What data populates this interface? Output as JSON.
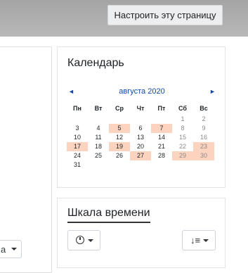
{
  "header": {
    "customize_label": "Настроить эту страницу"
  },
  "main": {
    "select_value": "а"
  },
  "calendar": {
    "title": "Календарь",
    "month": "августа 2020",
    "prev_symbol": "◄",
    "next_symbol": "►",
    "weekdays": [
      "Пн",
      "Вт",
      "Ср",
      "Чт",
      "Пт",
      "Сб",
      "Вс"
    ],
    "weeks": [
      [
        "",
        "",
        "",
        "",
        "",
        "1",
        "2"
      ],
      [
        "3",
        "4",
        "5",
        "6",
        "7",
        "8",
        "9"
      ],
      [
        "10",
        "11",
        "12",
        "13",
        "14",
        "15",
        "16"
      ],
      [
        "17",
        "18",
        "19",
        "20",
        "21",
        "22",
        "23"
      ],
      [
        "24",
        "25",
        "26",
        "27",
        "28",
        "29",
        "30"
      ],
      [
        "31",
        "",
        "",
        "",
        "",
        "",
        ""
      ]
    ],
    "event_days": [
      "5",
      "7",
      "17",
      "19",
      "23",
      "27",
      "29",
      "30"
    ],
    "event_color": "#fcd3bf"
  },
  "timeline": {
    "title": "Шкала времени",
    "filter_icon": "clock-icon",
    "sort_icon": "sort-icon",
    "sort_glyph": "↓≡"
  }
}
